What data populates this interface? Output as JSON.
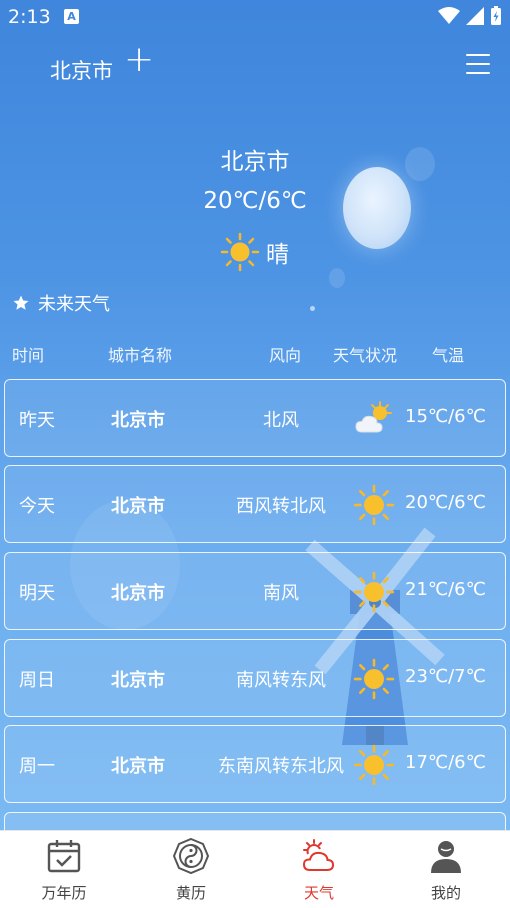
{
  "status_bar": {
    "time": "2:13"
  },
  "header": {
    "city": "北京市",
    "add_label": "+"
  },
  "hero": {
    "city": "北京市",
    "temp": "20℃/6℃",
    "condition": "晴"
  },
  "future_label": "未来天气",
  "columns": [
    "时间",
    "城市名称",
    "风向",
    "天气状况",
    "气温"
  ],
  "rows": [
    {
      "day": "昨天",
      "city": "北京市",
      "wind": "北风",
      "icon": "partly-cloudy-icon",
      "temp": "15℃/6℃"
    },
    {
      "day": "今天",
      "city": "北京市",
      "wind": "西风转北风",
      "icon": "sun-icon",
      "temp": "20℃/6℃"
    },
    {
      "day": "明天",
      "city": "北京市",
      "wind": "南风",
      "icon": "sun-icon",
      "temp": "21℃/6℃"
    },
    {
      "day": "周日",
      "city": "北京市",
      "wind": "南风转东风",
      "icon": "sun-icon",
      "temp": "23℃/7℃"
    },
    {
      "day": "周一",
      "city": "北京市",
      "wind": "东南风转东北风",
      "icon": "sun-icon",
      "temp": "17℃/6℃"
    }
  ],
  "nav": [
    {
      "label": "万年历",
      "icon": "calendar-icon"
    },
    {
      "label": "黄历",
      "icon": "taiji-icon"
    },
    {
      "label": "天气",
      "icon": "weather-icon",
      "active": true
    },
    {
      "label": "我的",
      "icon": "user-icon"
    }
  ],
  "colors": {
    "active_nav": "#e0382f",
    "sun": "#f7b928"
  }
}
